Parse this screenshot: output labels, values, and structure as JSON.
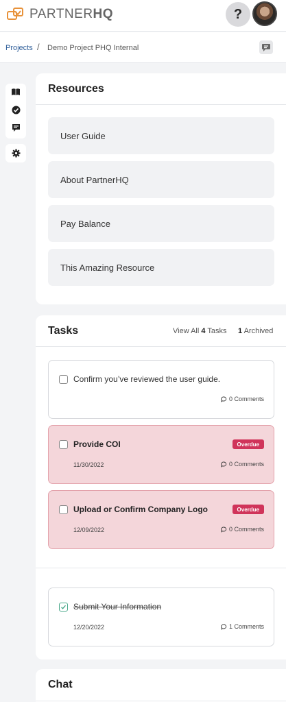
{
  "header": {
    "brand_light": "PARTNER",
    "brand_bold": "HQ",
    "help_label": "?"
  },
  "breadcrumb": {
    "projects_label": "Projects",
    "separator": "/",
    "current_label": "Demo Project PHQ Internal"
  },
  "rail": {
    "icons": [
      "book-icon",
      "check-circle-icon",
      "chat-bubble-icon",
      "gear-icon"
    ]
  },
  "resources": {
    "title": "Resources",
    "items": [
      {
        "label": "User Guide"
      },
      {
        "label": "About PartnerHQ"
      },
      {
        "label": "Pay Balance"
      },
      {
        "label": "This Amazing Resource"
      }
    ]
  },
  "tasks": {
    "title": "Tasks",
    "view_all_prefix": "View All",
    "view_all_count": "4",
    "view_all_suffix": "Tasks",
    "archived_count": "1",
    "archived_label": "Archived",
    "items": [
      {
        "title": "Confirm you’ve reviewed the user guide.",
        "comments": "0 Comments",
        "status": "open"
      },
      {
        "title": "Provide COI",
        "date": "11/30/2022",
        "badge": "Overdue",
        "comments": "0 Comments",
        "status": "overdue"
      },
      {
        "title": "Upload or Confirm Company Logo",
        "date": "12/09/2022",
        "badge": "Overdue",
        "comments": "0 Comments",
        "status": "overdue"
      }
    ],
    "completed": [
      {
        "title": "Submit Your Information",
        "date": "12/20/2022",
        "comments": "1 Comments",
        "status": "done"
      }
    ]
  },
  "chat": {
    "title": "Chat"
  },
  "colors": {
    "brand_orange": "#e8923a",
    "link_blue": "#2d5d99",
    "overdue_bg": "#f4d6da",
    "overdue_badge": "#d0345a",
    "done_check": "#4aa88a"
  }
}
